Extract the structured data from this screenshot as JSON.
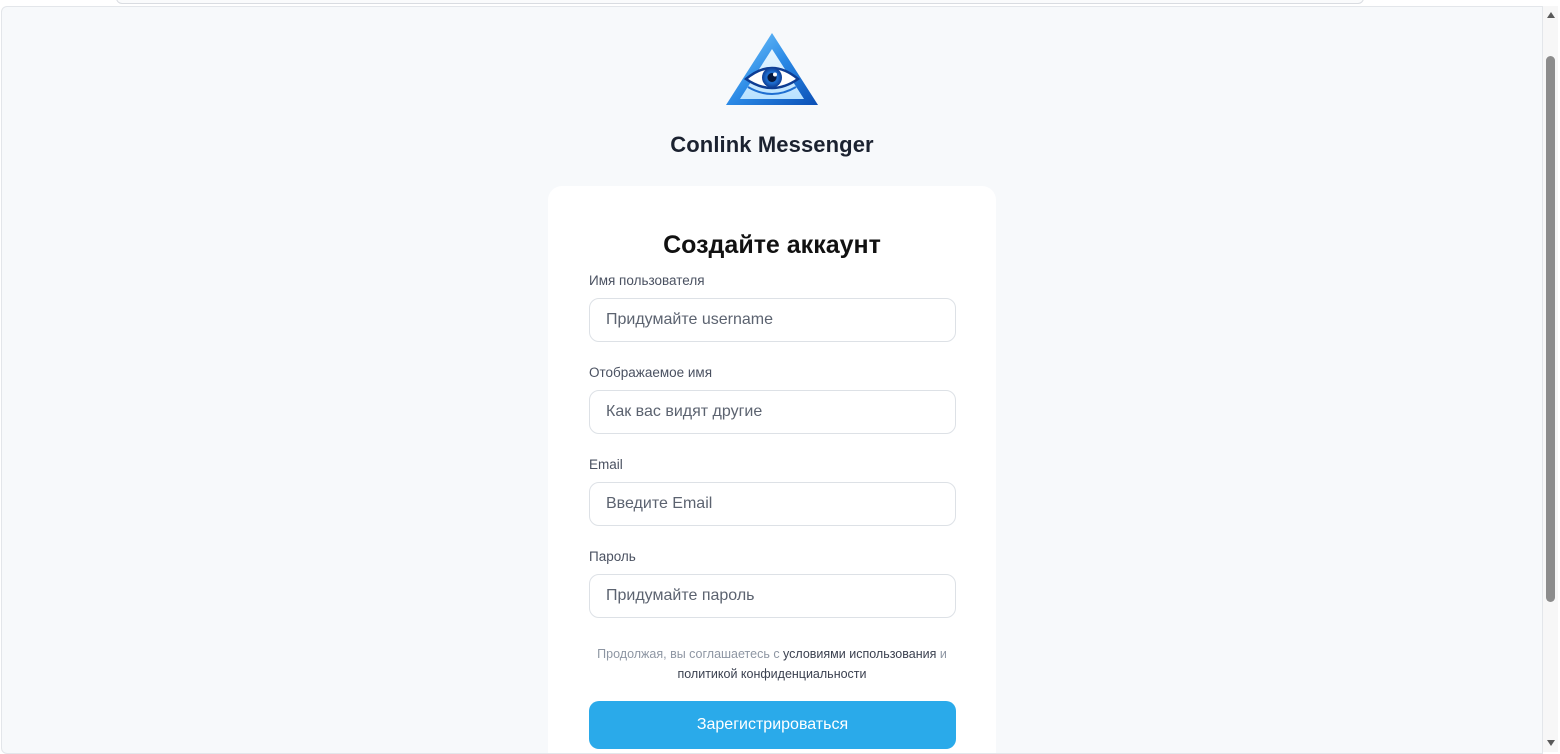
{
  "app": {
    "name": "Conlink Messenger",
    "logo_icon": "eye-triangle-icon",
    "accent_color": "#2aaaea"
  },
  "form": {
    "title": "Создайте аккаунт",
    "fields": [
      {
        "label": "Имя пользователя",
        "value": "",
        "placeholder": "Придумайте username"
      },
      {
        "label": "Отображаемое имя",
        "value": "",
        "placeholder": "Как вас видят другие"
      },
      {
        "label": "Email",
        "value": "",
        "placeholder": "Введите Email"
      },
      {
        "label": "Пароль",
        "value": "",
        "placeholder": "Придумайте пароль"
      }
    ],
    "terms": {
      "prefix": "Продолжая, вы соглашаетесь с ",
      "terms_link": "условиями использования",
      "conjunction": " и ",
      "privacy_link": "политикой конфиденциальности"
    },
    "submit_label": "Зарегистрироваться"
  }
}
